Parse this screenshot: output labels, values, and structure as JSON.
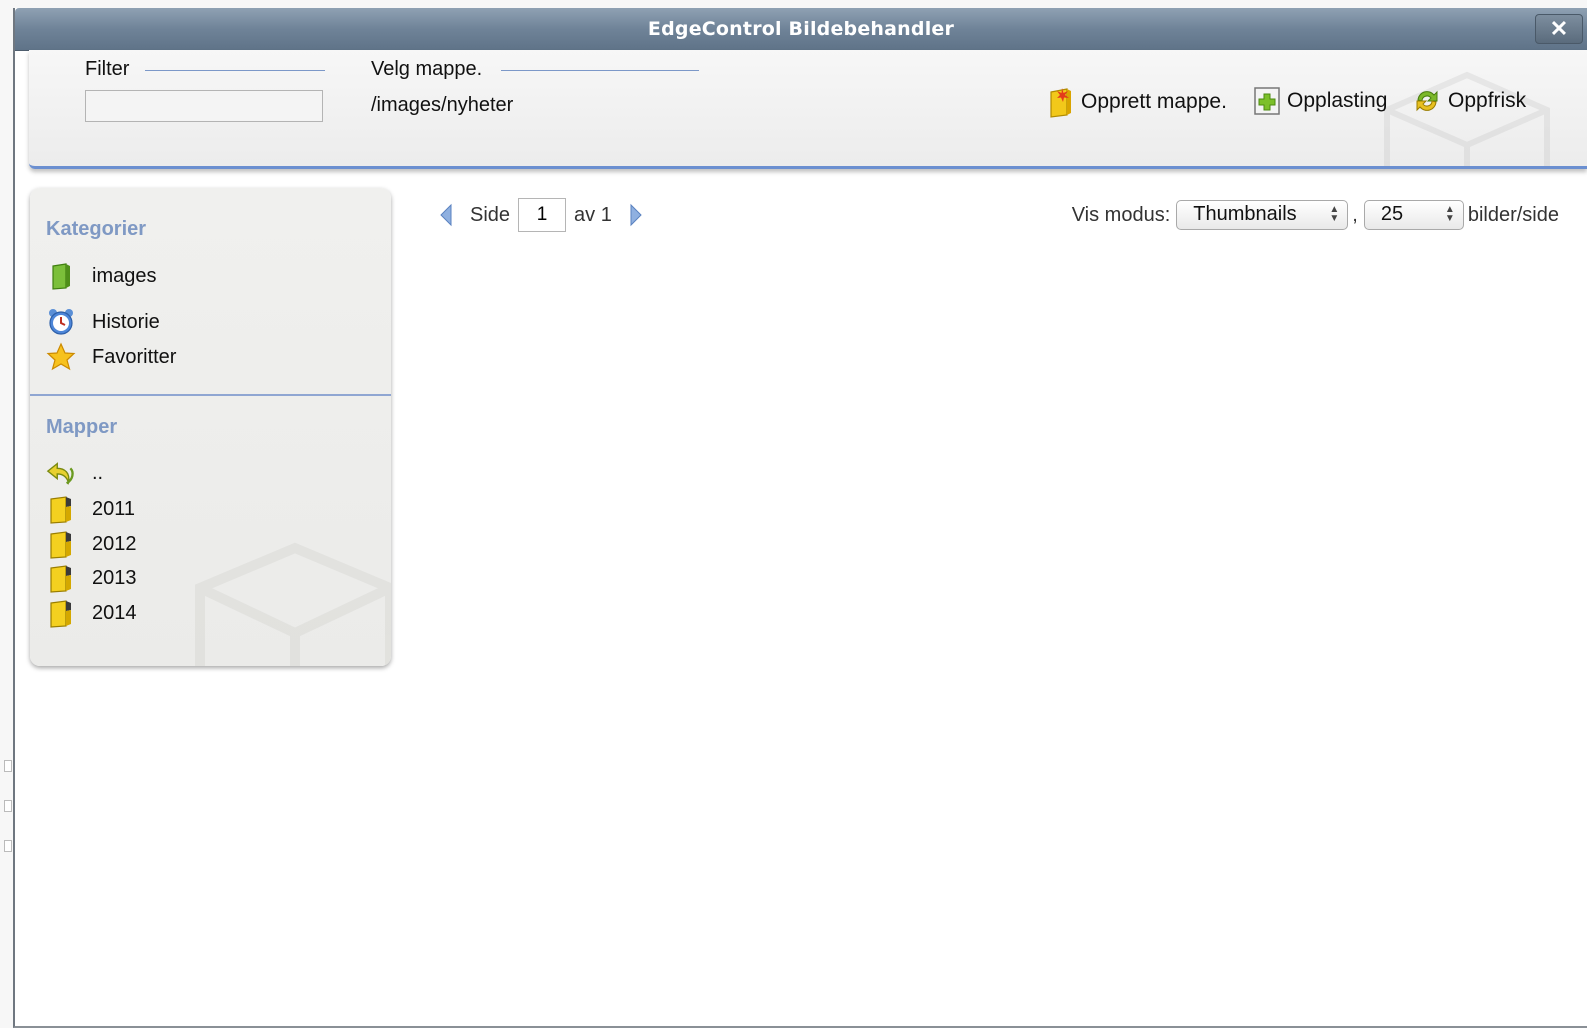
{
  "window": {
    "title": "EdgeControl Bildebehandler",
    "close_label": "✕"
  },
  "toolbar": {
    "filter_label": "Filter",
    "filter_value": "",
    "folder_label": "Velg mappe.",
    "folder_path": "/images/nyheter",
    "actions": [
      {
        "label": "Opprett mappe.",
        "icon": "new-folder-icon"
      },
      {
        "label": "Opplasting",
        "icon": "upload-icon"
      },
      {
        "label": "Oppfrisk",
        "icon": "refresh-icon"
      }
    ]
  },
  "sidebar": {
    "categories_title": "Kategorier",
    "categories": [
      {
        "label": "images",
        "icon": "green-book-icon"
      },
      {
        "label": "Historie",
        "icon": "alarm-clock-icon"
      },
      {
        "label": "Favoritter",
        "icon": "star-icon"
      }
    ],
    "folders_title": "Mapper",
    "folders": [
      {
        "label": "..",
        "icon": "up-arrow-icon"
      },
      {
        "label": "2011",
        "icon": "folder-icon"
      },
      {
        "label": "2012",
        "icon": "folder-icon"
      },
      {
        "label": "2013",
        "icon": "folder-icon"
      },
      {
        "label": "2014",
        "icon": "folder-icon"
      }
    ]
  },
  "pager": {
    "side_label": "Side",
    "current_page": "1",
    "of_label": "av 1"
  },
  "view": {
    "mode_label": "Vis modus:",
    "mode_value": "Thumbnails",
    "separator": ",",
    "per_page_value": "25",
    "per_page_suffix": "bilder/side"
  },
  "colors": {
    "accent_blue": "#6b8fd0",
    "section_title": "#7f99c4",
    "titlebar": "#6f8398"
  }
}
